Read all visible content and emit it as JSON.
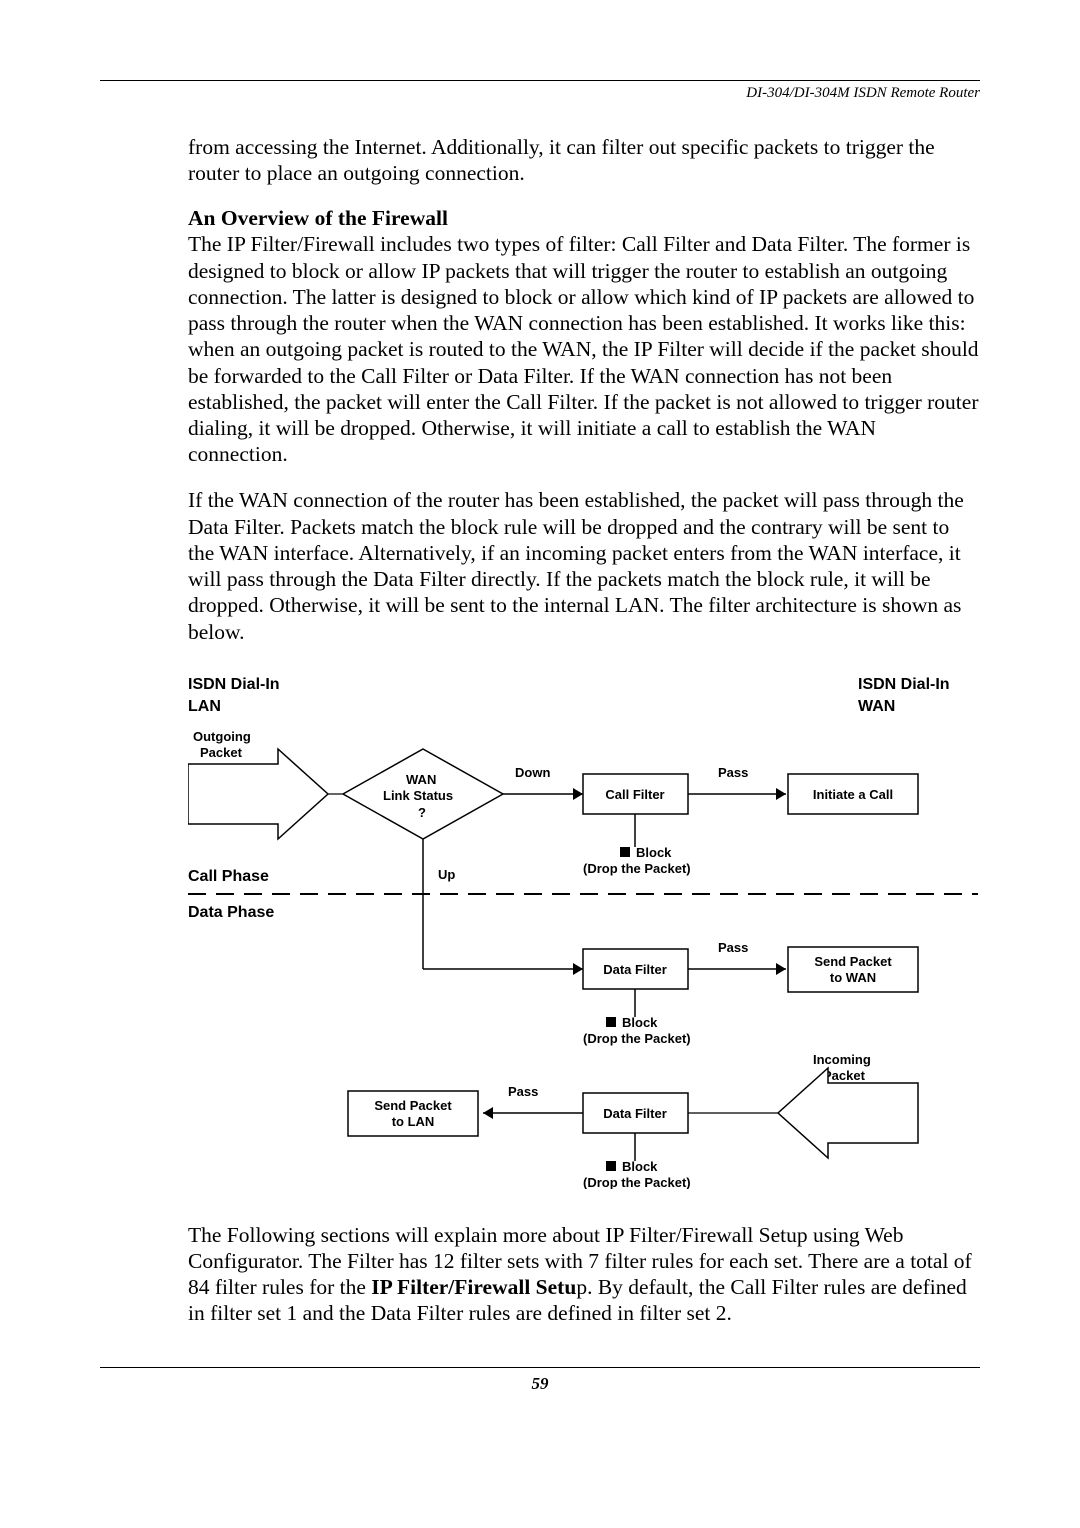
{
  "header": {
    "running_title": "DI-304/DI-304M ISDN Remote Router"
  },
  "paragraphs": {
    "p1": "from accessing the Internet. Additionally, it can filter out specific packets to trigger the router to place an outgoing connection.",
    "sect_title": "An Overview of the Firewall",
    "p2": "The IP Filter/Firewall includes two types of filter: Call Filter and Data Filter. The former is designed to block or allow IP packets that will trigger the router to establish an outgoing connection. The latter is designed to block or allow which kind of IP packets are allowed to pass through the router when the WAN connection has been established. It works like this: when an outgoing packet is routed to the WAN, the IP Filter will decide if the packet should be forwarded to the Call Filter or Data Filter. If the WAN connection has not been established, the packet will enter the Call Filter. If the packet is not allowed to trigger router dialing, it will be dropped. Otherwise, it will initiate a call to establish the WAN connection.",
    "p3": "If the WAN connection of the router has been established, the packet will pass through the Data Filter. Packets match the block rule will be dropped and the contrary will be sent to the WAN interface. Alternatively, if an incoming packet enters from the WAN interface, it will pass through the Data Filter directly. If the packets match the block rule, it will be dropped. Otherwise, it will be sent to the internal LAN. The filter architecture is shown as below.",
    "p4a": "The Following sections will explain more about IP Filter/Firewall Setup using Web Configurator. The Filter has 12 filter sets with 7 filter rules for each set. There are a total of 84 filter rules for the ",
    "p4b_bold": "IP Filter/Firewall Setu",
    "p4c": "p. By default, the Call Filter rules are defined in filter set 1 and the Data Filter rules are defined in filter set 2."
  },
  "diagram": {
    "top_left_1": "ISDN Dial-In",
    "top_left_2": "LAN",
    "top_right_1": "ISDN Dial-In",
    "top_right_2": "WAN",
    "outgoing_packet_1": "Outgoing",
    "outgoing_packet_2": "Packet",
    "wan_link_1": "WAN",
    "wan_link_2": "Link Status",
    "wan_link_3": "?",
    "down": "Down",
    "call_filter": "Call Filter",
    "pass": "Pass",
    "initiate_call": "Initiate a Call",
    "block": "Block",
    "drop": "(Drop the Packet)",
    "up": "Up",
    "call_phase": "Call Phase",
    "data_phase": "Data Phase",
    "data_filter": "Data Filter",
    "send_wan_1": "Send Packet",
    "send_wan_2": "to WAN",
    "incoming_1": "Incoming",
    "incoming_2": "Packet",
    "send_lan_1": "Send Packet",
    "send_lan_2": "to LAN"
  },
  "footer": {
    "page_number": "59"
  }
}
